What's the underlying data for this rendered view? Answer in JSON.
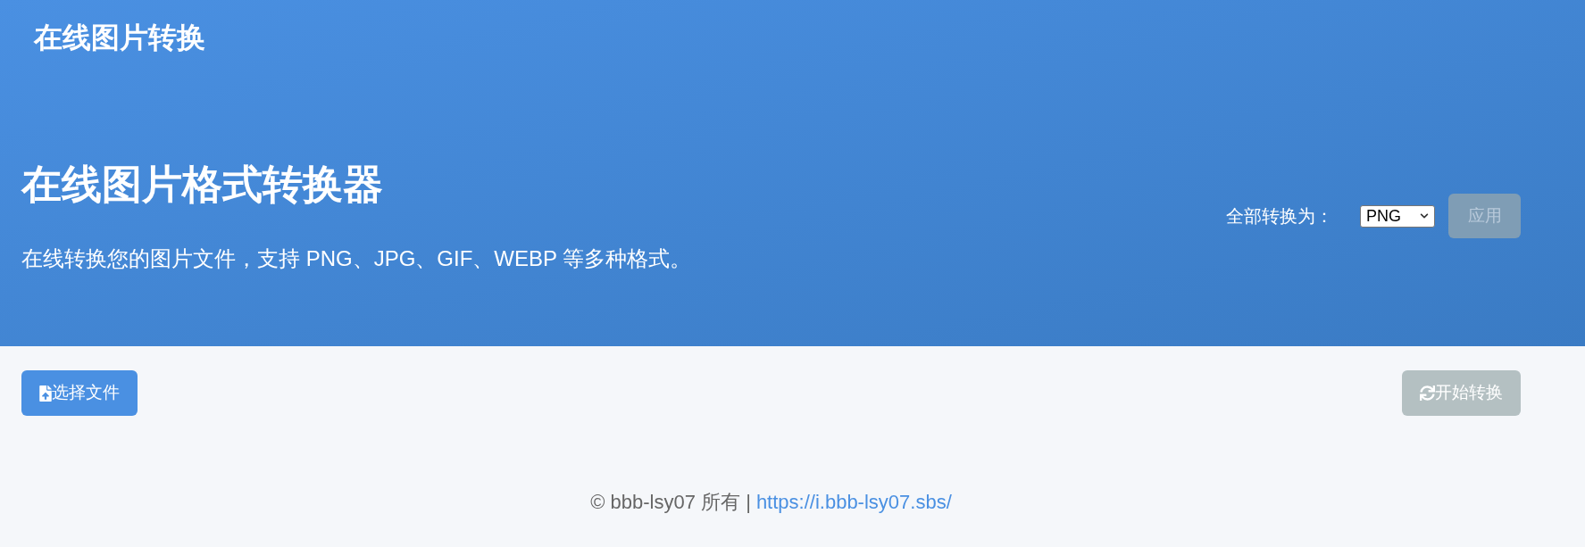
{
  "navbar": {
    "title": "在线图片转换"
  },
  "hero": {
    "title": "在线图片格式转换器",
    "subtitle": "在线转换您的图片文件，支持 PNG、JPG、GIF、WEBP 等多种格式。",
    "convert_all": {
      "label": "全部转换为：",
      "format": {
        "value": "PNG"
      },
      "apply_button": {
        "label": "应用",
        "disabled": true
      }
    }
  },
  "toolbar": {
    "buttons": [
      {
        "kind": "upload",
        "label": "选择文件",
        "disabled": false
      },
      {
        "kind": "convert",
        "label": "开始转换",
        "disabled": true
      }
    ]
  },
  "footer": {
    "text": "© bbb-lsy07 所有 |",
    "link": "https://i.bbb-lsy07.sbs/"
  }
}
